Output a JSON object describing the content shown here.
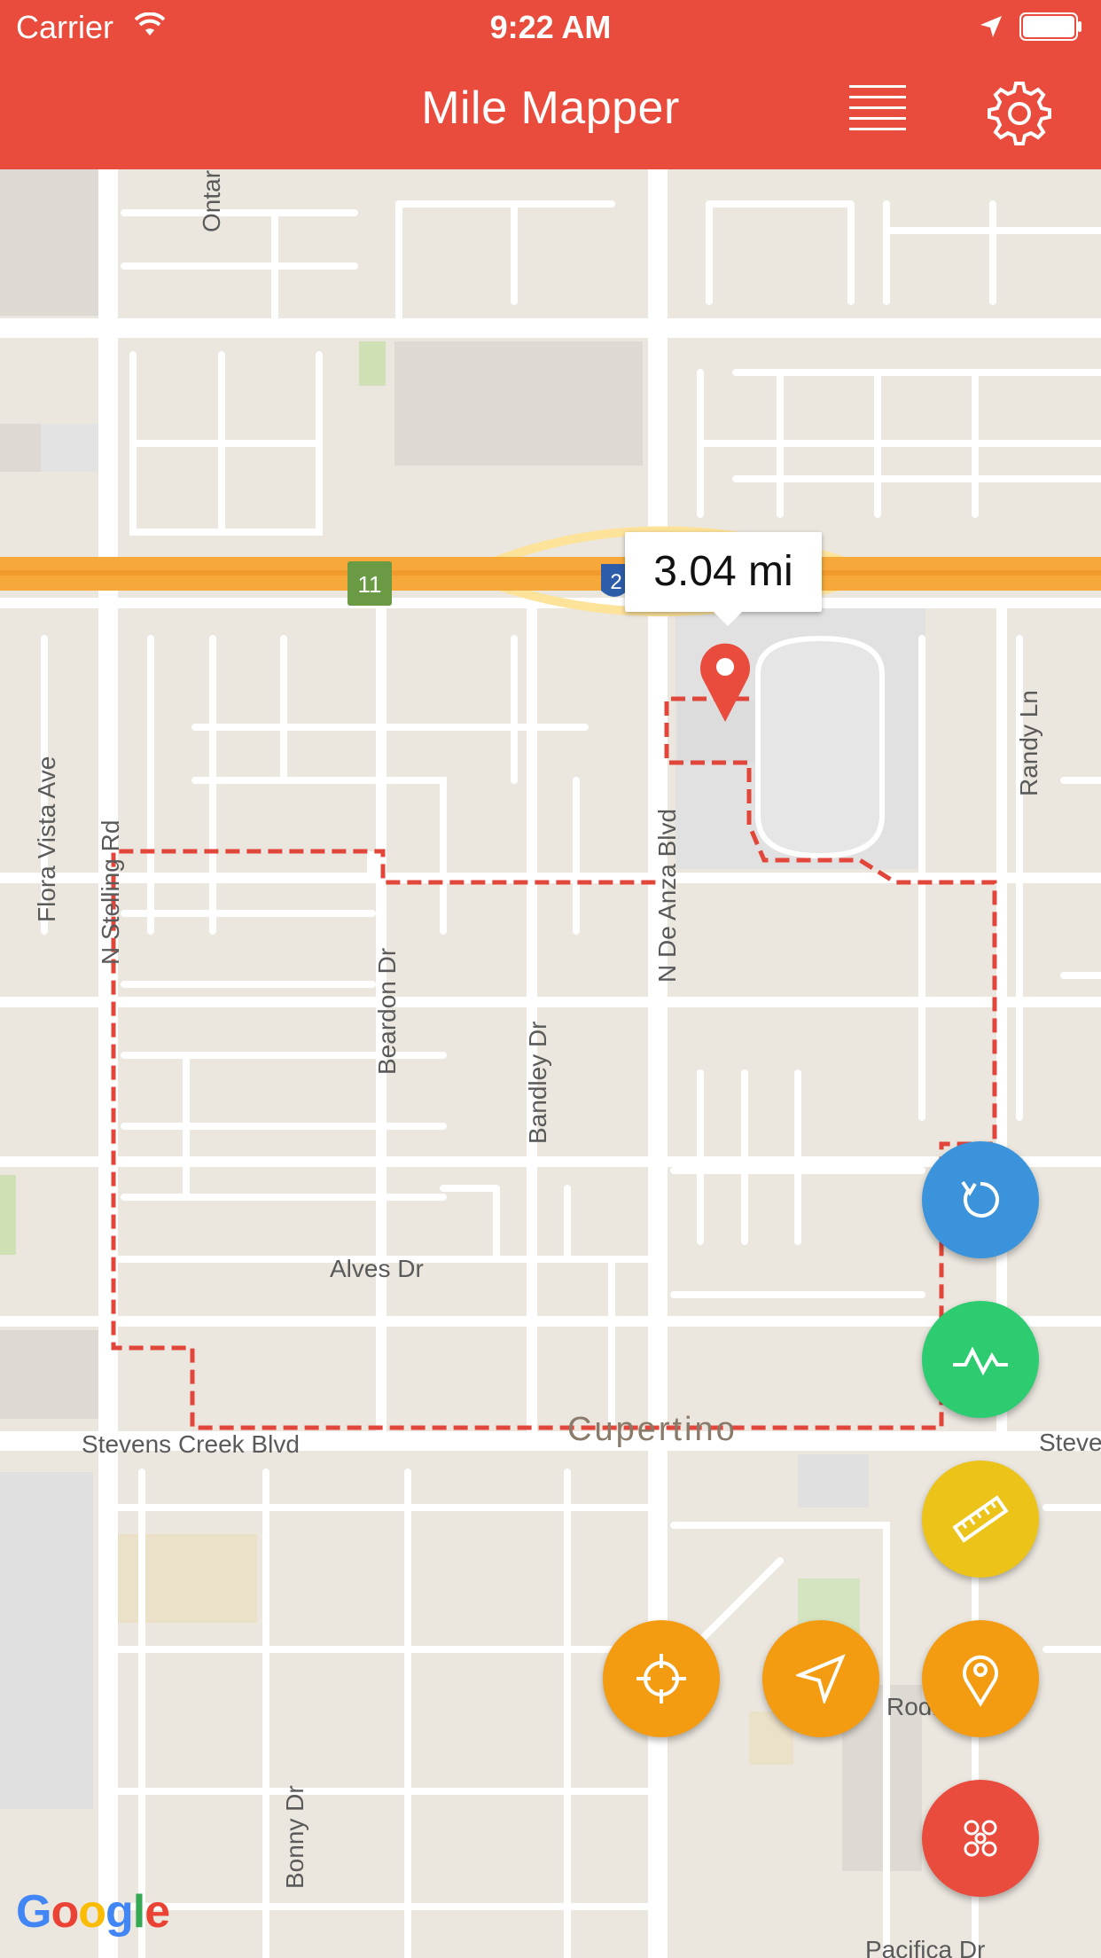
{
  "status_bar": {
    "carrier": "Carrier",
    "time": "9:22 AM",
    "icons": [
      "wifi-icon",
      "location-arrow-icon",
      "battery-icon"
    ]
  },
  "header": {
    "title": "Mile Mapper",
    "background": "#e94b3c",
    "list_icon": "list-icon",
    "settings_icon": "gear-icon"
  },
  "map": {
    "streets": {
      "ontario": "Ontar",
      "flora_vista": "Flora Vista Ave",
      "n_stelling": "N Stelling Rd",
      "beardon": "Beardon Dr",
      "bandley": "Bandley Dr",
      "n_de_anza": "N De Anza Blvd",
      "randy": "Randy Ln",
      "alves": "Alves Dr",
      "stevens_creek": "Stevens Creek Blvd",
      "stevens_right": "Steve",
      "city": "Cupertino",
      "bonny": "Bonny Dr",
      "rodrig": "Rodrig",
      "pacifica": "Pacifica Dr"
    },
    "highway_shield": "11",
    "interstate_shield": "2",
    "distance_label": "3.04 mi",
    "route_color": "#e2453a",
    "attribution": "Google"
  },
  "buttons": {
    "reset": {
      "icon": "reset-icon",
      "color": "#3a93db"
    },
    "elevation": {
      "icon": "elevation-chart-icon",
      "color": "#2ecc71"
    },
    "measure": {
      "icon": "ruler-icon",
      "color": "#ecc318"
    },
    "drop_pin": {
      "icon": "map-pin-icon",
      "color": "#f39c12"
    },
    "navigate": {
      "icon": "navigation-arrow-icon",
      "color": "#f39c12"
    },
    "locate": {
      "icon": "crosshair-icon",
      "color": "#f39c12"
    },
    "menu": {
      "icon": "cluster-menu-icon",
      "color": "#e94b3c"
    }
  }
}
